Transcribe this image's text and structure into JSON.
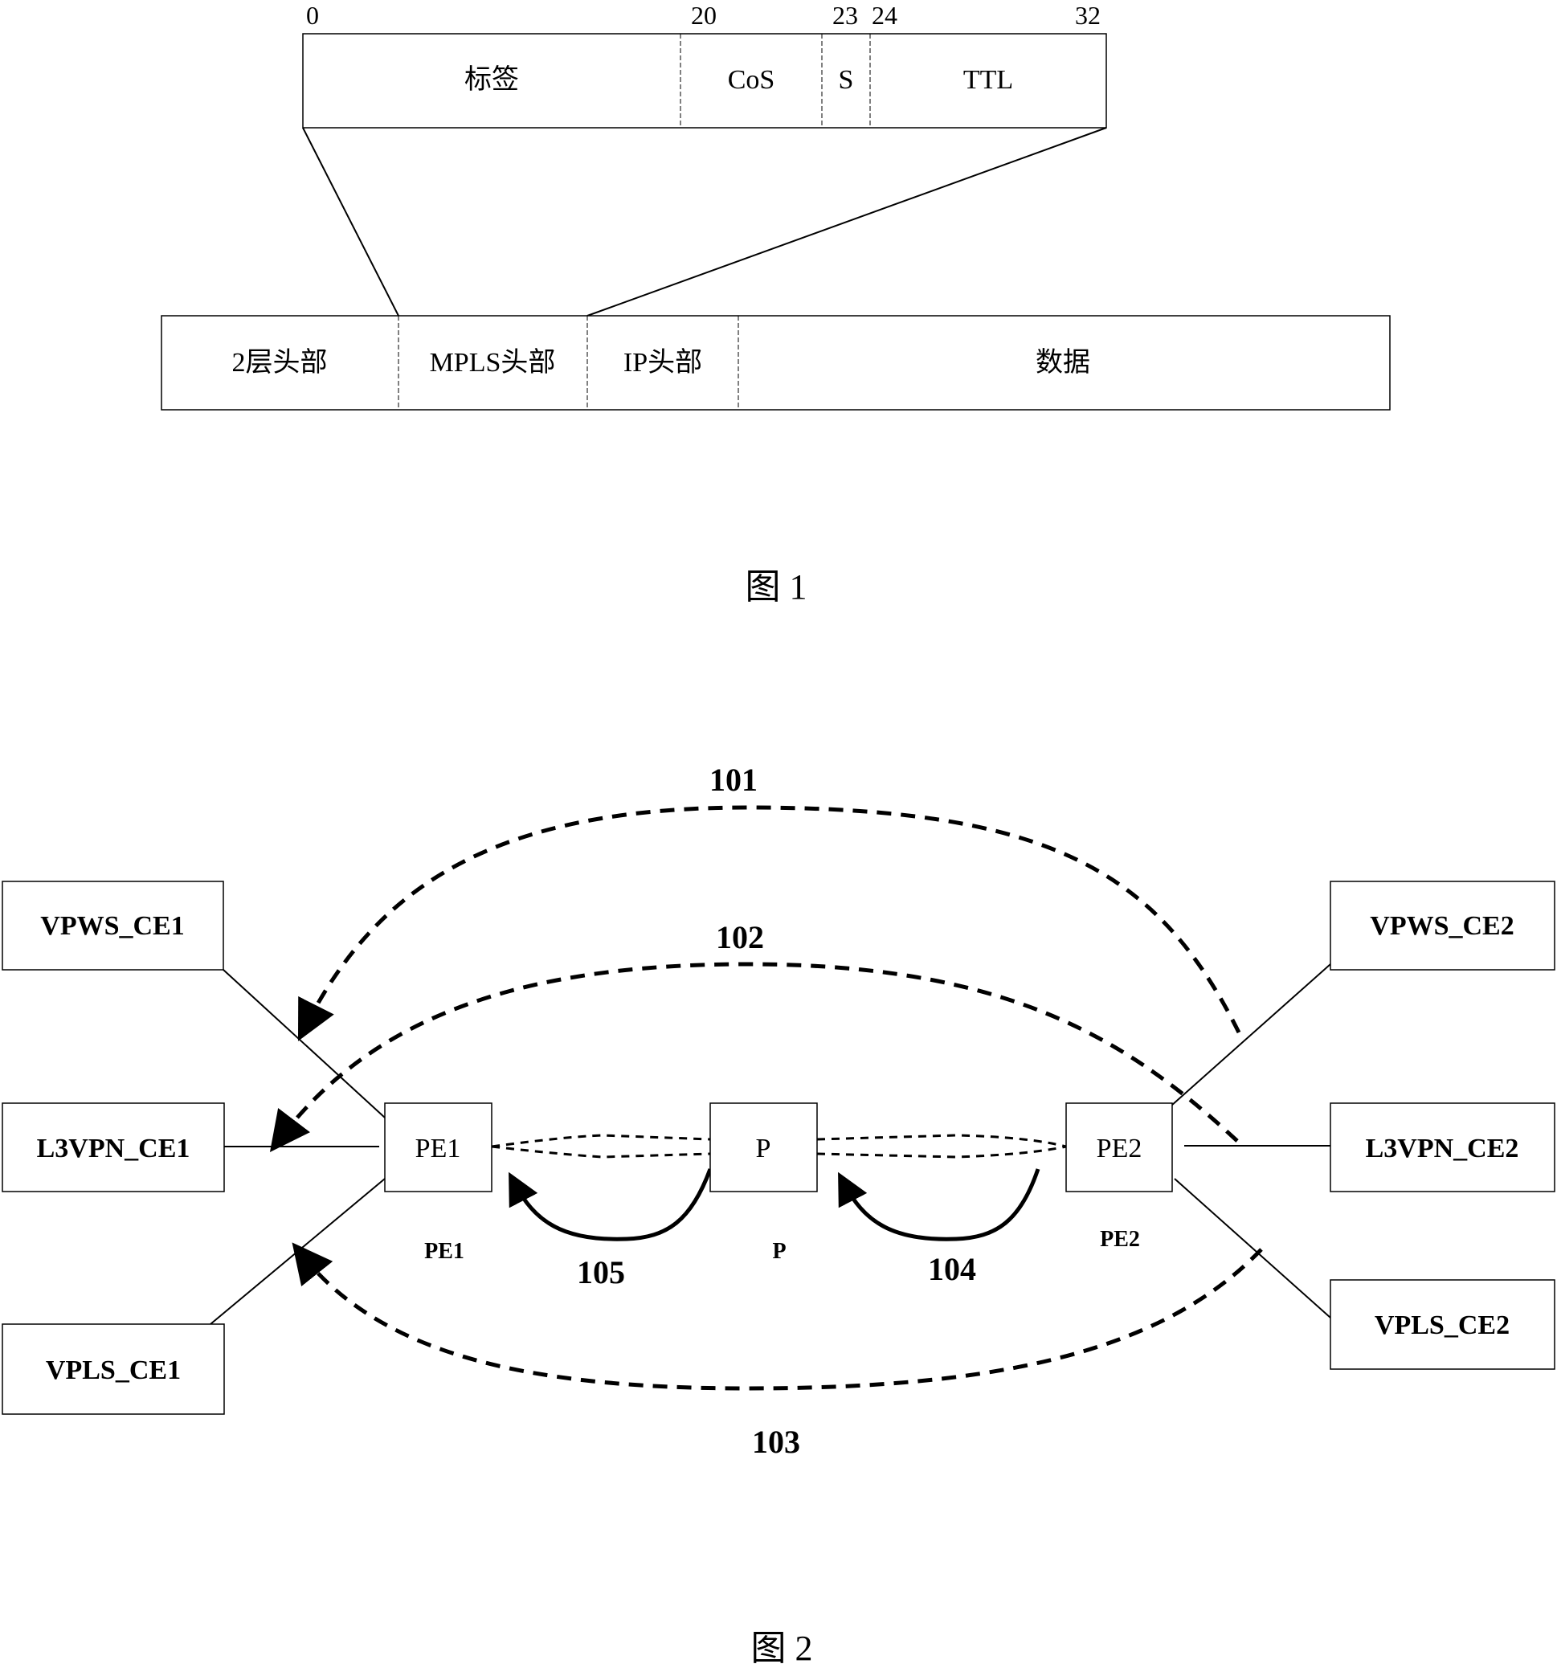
{
  "figure1": {
    "caption": "图 1",
    "bit_ticks": [
      "0",
      "20",
      "23",
      "24",
      "32"
    ],
    "label_fields": [
      "标签",
      "CoS",
      "S",
      "TTL"
    ],
    "packet_fields": [
      "2层头部",
      "MPLS头部",
      "IP头部",
      "数据"
    ]
  },
  "figure2": {
    "caption": "图 2",
    "nodes": {
      "vpws_ce1": "VPWS_CE1",
      "l3vpn_ce1": "L3VPN_CE1",
      "vpls_ce1": "VPLS_CE1",
      "pe1": "PE1",
      "p": "P",
      "pe2": "PE2",
      "vpws_ce2": "VPWS_CE2",
      "l3vpn_ce2": "L3VPN_CE2",
      "vpls_ce2": "VPLS_CE2"
    },
    "node_labels": {
      "pe1": "PE1",
      "p": "P",
      "pe2": "PE2"
    },
    "paths": {
      "p101": "101",
      "p102": "102",
      "p103": "103",
      "p104": "104",
      "p105": "105"
    }
  }
}
